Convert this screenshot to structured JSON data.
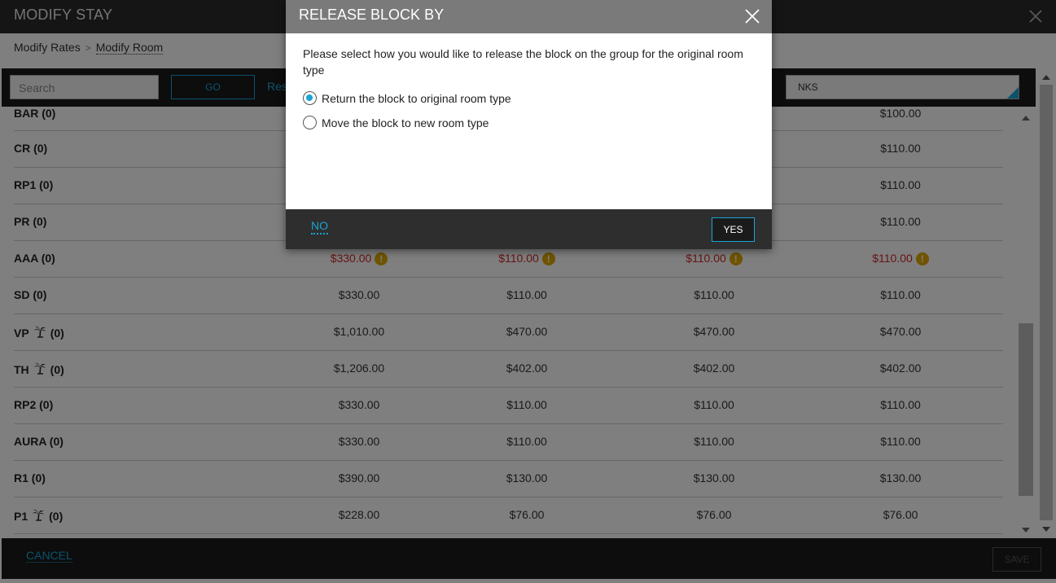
{
  "page": {
    "title": "MODIFY STAY",
    "breadcrumb": {
      "item1": "Modify Rates",
      "separator": ">",
      "item2": "Modify Room"
    },
    "toolbar": {
      "search_placeholder": "Search",
      "go_label": "GO",
      "reset_label": "Res",
      "selector_value": "NKS"
    },
    "rows": [
      {
        "name": "BAR (0)",
        "icon": null,
        "values": [
          "",
          "",
          "",
          "$100.00"
        ],
        "warning": false
      },
      {
        "name": "CR (0)",
        "icon": null,
        "values": [
          "",
          "",
          "",
          "$110.00"
        ],
        "warning": false
      },
      {
        "name": "RP1 (0)",
        "icon": null,
        "values": [
          "",
          "",
          "",
          "$110.00"
        ],
        "warning": false
      },
      {
        "name": "PR (0)",
        "icon": null,
        "values": [
          "",
          "",
          "",
          "$110.00"
        ],
        "warning": false
      },
      {
        "name": "AAA (0)",
        "icon": null,
        "values": [
          "$330.00",
          "$110.00",
          "$110.00",
          "$110.00"
        ],
        "warning": true
      },
      {
        "name": "SD (0)",
        "icon": null,
        "values": [
          "$330.00",
          "$110.00",
          "$110.00",
          "$110.00"
        ],
        "warning": false
      },
      {
        "name": "VP",
        "suffix": "(0)",
        "icon": "palm-tree-icon",
        "values": [
          "$1,010.00",
          "$470.00",
          "$470.00",
          "$470.00"
        ],
        "warning": false
      },
      {
        "name": "TH",
        "suffix": "(0)",
        "icon": "palm-tree-icon",
        "values": [
          "$1,206.00",
          "$402.00",
          "$402.00",
          "$402.00"
        ],
        "warning": false
      },
      {
        "name": "RP2 (0)",
        "icon": null,
        "values": [
          "$330.00",
          "$110.00",
          "$110.00",
          "$110.00"
        ],
        "warning": false
      },
      {
        "name": "AURA (0)",
        "icon": null,
        "values": [
          "$330.00",
          "$110.00",
          "$110.00",
          "$110.00"
        ],
        "warning": false
      },
      {
        "name": "R1 (0)",
        "icon": null,
        "values": [
          "$390.00",
          "$130.00",
          "$130.00",
          "$130.00"
        ],
        "warning": false
      },
      {
        "name": "P1",
        "suffix": "(0)",
        "icon": "palm-tree-icon",
        "values": [
          "$228.00",
          "$76.00",
          "$76.00",
          "$76.00"
        ],
        "warning": false
      }
    ],
    "footer": {
      "cancel_label": "CANCEL",
      "save_label": "SAVE"
    }
  },
  "dialog": {
    "title": "RELEASE BLOCK BY",
    "prompt": "Please select how you would like to release the block on the group for the original room type",
    "options": [
      {
        "label": "Return the block to original room type",
        "checked": true
      },
      {
        "label": "Move the block to new room type",
        "checked": false
      }
    ],
    "no_label": "NO",
    "yes_label": "YES"
  },
  "colors": {
    "accent": "#19a5d6",
    "warning_text": "#d0262c",
    "warning_icon": "#e0a800",
    "dark_bar": "#1b1b1b"
  }
}
